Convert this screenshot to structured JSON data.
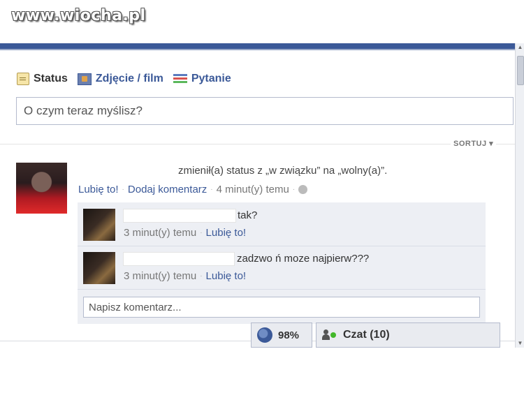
{
  "watermark": "www.wiocha.pl",
  "composer": {
    "tabs": [
      {
        "label": "Status",
        "icon": "status-icon",
        "active": true
      },
      {
        "label": "Zdjęcie / film",
        "icon": "photo-icon",
        "active": false
      },
      {
        "label": "Pytanie",
        "icon": "question-icon",
        "active": false
      }
    ],
    "placeholder": "O czym teraz myślisz?"
  },
  "feed": {
    "sort_label": "SORTUJ ▾",
    "post": {
      "status_text": "zmienił(a) status z „w związku” na „wolny(a)”.",
      "like": "Lubię to!",
      "comment": "Dodaj komentarz",
      "time": "4 minut(y) temu"
    },
    "comments": [
      {
        "text": "tak?",
        "time": "3 minut(y) temu",
        "like": "Lubię to!"
      },
      {
        "text": "zadzwo ń moze najpierw???",
        "time": "3 minut(y) temu",
        "like": "Lubię to!"
      }
    ],
    "comment_placeholder": "Napisz komentarz..."
  },
  "chatbar": {
    "connection": "98%",
    "chat_label": "Czat (10)"
  },
  "colors": {
    "brand": "#3b5998",
    "online": "#42b72a"
  }
}
